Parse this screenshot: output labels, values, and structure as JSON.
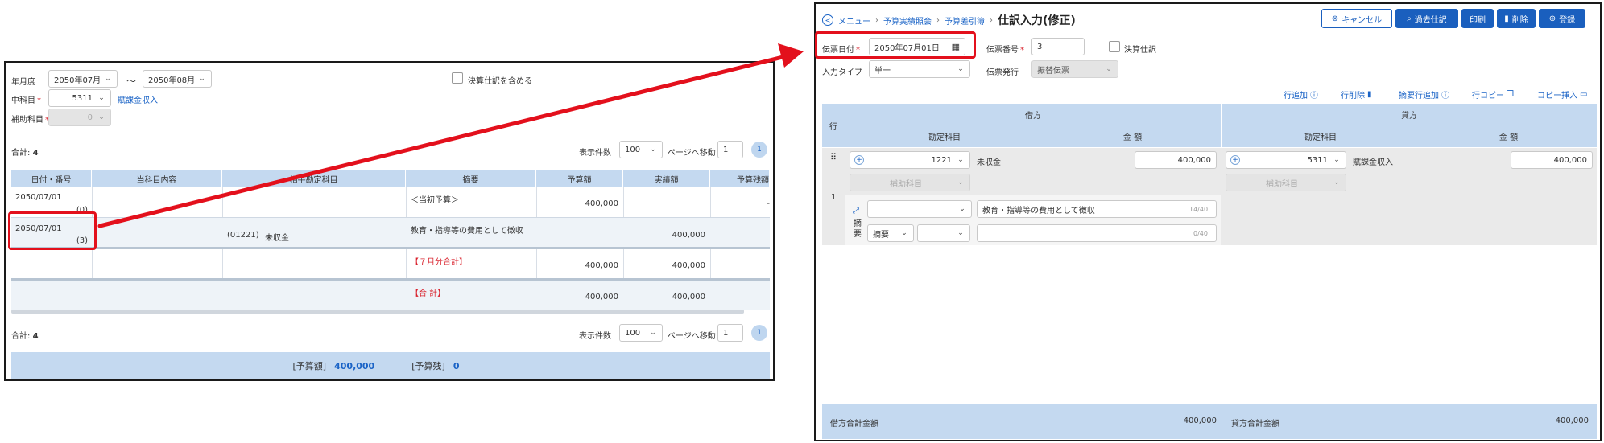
{
  "list_screen": {
    "filters": {
      "period_label": "年月度",
      "period_from": "2050年07月",
      "period_sep": "〜",
      "period_to": "2050年08月",
      "include_closing_label": "決算仕訳を含める",
      "middle_account_label": "中科目",
      "middle_account_code": "5311",
      "middle_account_name": "賦課金収入",
      "sub_account_label": "補助科目",
      "sub_account_value": "0"
    },
    "pager_top": {
      "total_label": "合計:",
      "total_count": "4",
      "page_size_label": "表示件数",
      "page_size": "100",
      "goto_label": "ページへ移動",
      "goto_page": "1",
      "current_page": "1"
    },
    "columns": [
      "日付・番号",
      "当科目内容",
      "相手勘定科目",
      "摘要",
      "予算額",
      "実績額",
      "予算残額"
    ],
    "rows": [
      {
        "date": "2050/07/01",
        "no": "(0)",
        "account_code": "",
        "account_name": "",
        "summary": "＜当初予算＞",
        "budget": "400,000",
        "actual": "",
        "remaining": "-"
      },
      {
        "date": "2050/07/01",
        "no": "(3)",
        "account_code": "(01221)",
        "account_name": "未収金",
        "summary": "教育・指導等の費用として徴収",
        "budget": "",
        "actual": "400,000",
        "remaining": ""
      },
      {
        "date": "",
        "no": "",
        "account_code": "",
        "account_name": "",
        "summary": "【７月分合計】",
        "budget": "400,000",
        "actual": "400,000",
        "remaining": ""
      },
      {
        "date": "",
        "no": "",
        "account_code": "",
        "account_name": "",
        "summary": "【合 計】",
        "budget": "400,000",
        "actual": "400,000",
        "remaining": ""
      }
    ],
    "pager_bottom": {
      "total_label": "合計:",
      "total_count": "4",
      "page_size_label": "表示件数",
      "page_size": "100",
      "goto_label": "ページへ移動",
      "goto_page": "1",
      "current_page": "1"
    },
    "footer": {
      "budget_label": "[予算額]",
      "budget_value": "400,000",
      "remaining_label": "[予算残]",
      "remaining_value": "0"
    }
  },
  "entry_screen": {
    "breadcrumb": [
      "メニュー",
      "予算実績照会",
      "予算差引簿"
    ],
    "title": "仕訳入力(修正)",
    "buttons": {
      "cancel": "キャンセル",
      "past": "過去仕訳",
      "print": "印刷",
      "delete": "削除",
      "register": "登録"
    },
    "form": {
      "date_label": "伝票日付",
      "date_value": "2050年07月01日",
      "voucher_no_label": "伝票番号",
      "voucher_no_value": "3",
      "closing_label": "決算仕訳",
      "input_type_label": "入力タイプ",
      "input_type_value": "単一",
      "issue_label": "伝票発行",
      "issue_value": "振替伝票"
    },
    "toolbar": {
      "add_row": "行追加",
      "delete_row": "行削除",
      "add_summary_row": "摘要行追加",
      "copy_row": "行コピー",
      "paste_row": "コピー挿入"
    },
    "grid": {
      "row_header": "行",
      "debit_header": "借方",
      "credit_header": "貸方",
      "account_header": "勘定科目",
      "amount_header": "金 額",
      "row_number": "1",
      "debit_code": "1221",
      "debit_name": "未収金",
      "debit_amount": "400,000",
      "credit_code": "5311",
      "credit_name": "賦課金収入",
      "credit_amount": "400,000",
      "sub_account_placeholder": "補助科目",
      "summary_label": "摘要",
      "summary_select": "摘要",
      "summary_text": "教育・指導等の費用として徴収",
      "summary_count": "14/40",
      "summary2_count": "0/40"
    },
    "totals": {
      "debit_label": "借方合計金額",
      "debit_value": "400,000",
      "credit_label": "貸方合計金額",
      "credit_value": "400,000"
    }
  },
  "colors": {
    "highlight": "#e3101c",
    "header_blue": "#c4d9f0",
    "primary": "#1a5fbe",
    "link": "#1a63c6"
  }
}
